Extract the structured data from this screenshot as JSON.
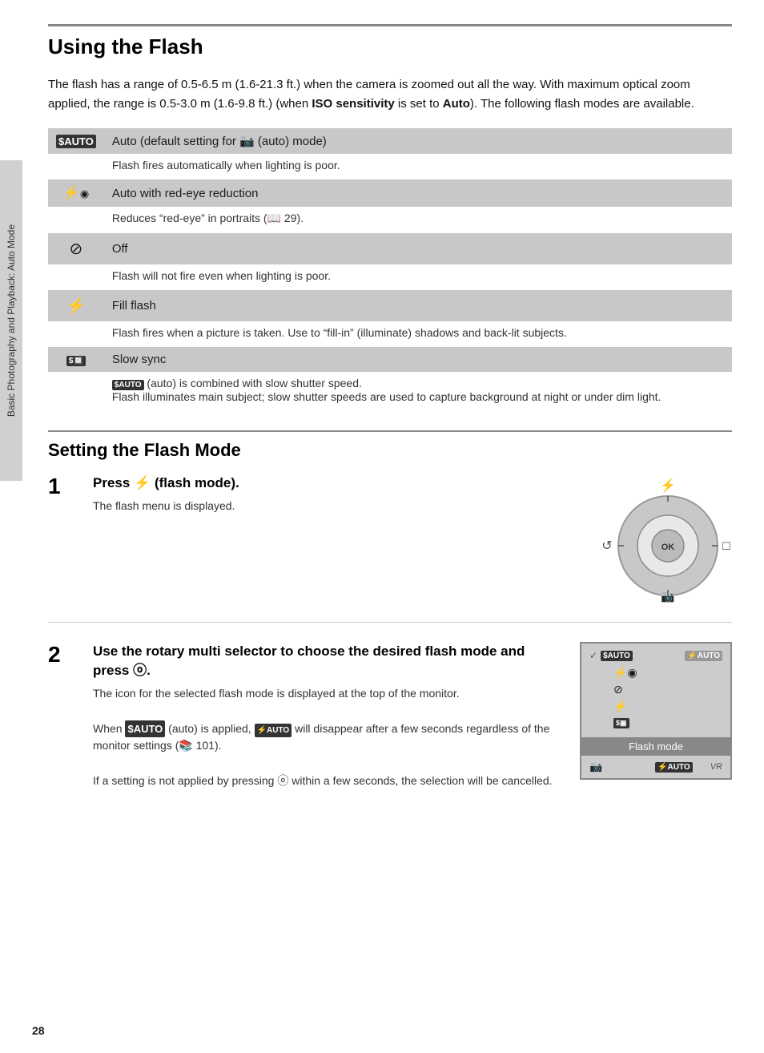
{
  "sidebar": {
    "label": "Basic Photography and Playback: Auto Mode"
  },
  "page": {
    "number": "28"
  },
  "title": "Using the Flash",
  "intro": "The flash has a range of 0.5-6.5 m (1.6-21.3 ft.) when the camera is zoomed out all the way. With maximum optical zoom applied, the range is 0.5-3.0 m (1.6-9.8 ft.) (when ISO sensitivity is set to Auto). The following flash modes are available.",
  "flash_modes": [
    {
      "icon": "AUTO",
      "label": "Auto (default setting for 📷 (auto) mode)",
      "desc": "Flash fires automatically when lighting is poor.",
      "icon_type": "auto_flash"
    },
    {
      "icon": "⚡◉",
      "label": "Auto with red-eye reduction",
      "desc": "Reduces “red-eye” in portraits (📖 29).",
      "icon_type": "redeye"
    },
    {
      "icon": "⊘",
      "label": "Off",
      "desc": "Flash will not fire even when lighting is poor.",
      "icon_type": "off"
    },
    {
      "icon": "⚡",
      "label": "Fill flash",
      "desc": "Flash fires when a picture is taken. Use to “fill-in” (illuminate) shadows and back-lit subjects.",
      "icon_type": "fill"
    },
    {
      "icon": "SLOW",
      "label": "Slow sync",
      "desc": "AUTO (auto) is combined with slow shutter speed.\nFlash illuminates main subject; slow shutter speeds are used to capture background at night or under dim light.",
      "icon_type": "slow"
    }
  ],
  "section2_title": "Setting the Flash Mode",
  "step1": {
    "number": "1",
    "title": "Press ⚡ (flash mode).",
    "desc": "The flash menu is displayed."
  },
  "step2": {
    "number": "2",
    "title": "Use the rotary multi selector to choose the desired flash mode and press ⓞ.",
    "desc1": "The icon for the selected flash mode is displayed at the top of the monitor.",
    "desc2": "When AUTO (auto) is applied, AUTO will disappear after a few seconds regardless of the monitor settings (📚 101).",
    "desc3": "If a setting is not applied by pressing ⓞ within a few seconds, the selection will be cancelled.",
    "menu_label": "Flash mode"
  }
}
